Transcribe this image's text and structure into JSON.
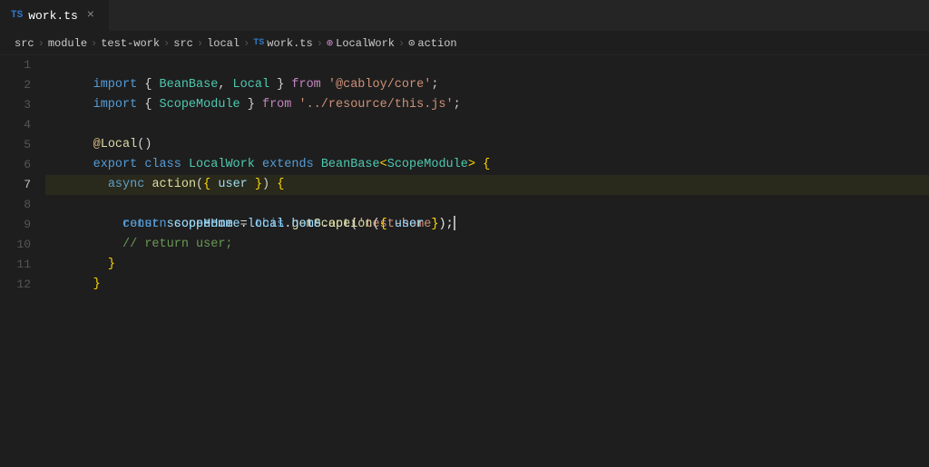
{
  "tab": {
    "icon": "TS",
    "label": "work.ts",
    "close_label": "×"
  },
  "breadcrumb": {
    "items": [
      {
        "text": "src",
        "type": "folder"
      },
      {
        "text": "module",
        "type": "folder"
      },
      {
        "text": "test-work",
        "type": "folder"
      },
      {
        "text": "src",
        "type": "folder"
      },
      {
        "text": "local",
        "type": "folder"
      },
      {
        "text": "work.ts",
        "type": "ts"
      },
      {
        "text": "LocalWork",
        "type": "class"
      },
      {
        "text": "action",
        "type": "method"
      }
    ]
  },
  "lines": [
    {
      "num": 1
    },
    {
      "num": 2
    },
    {
      "num": 3
    },
    {
      "num": 4
    },
    {
      "num": 5
    },
    {
      "num": 6
    },
    {
      "num": 7
    },
    {
      "num": 8
    },
    {
      "num": 9
    },
    {
      "num": 10
    },
    {
      "num": 11
    },
    {
      "num": 12
    }
  ]
}
